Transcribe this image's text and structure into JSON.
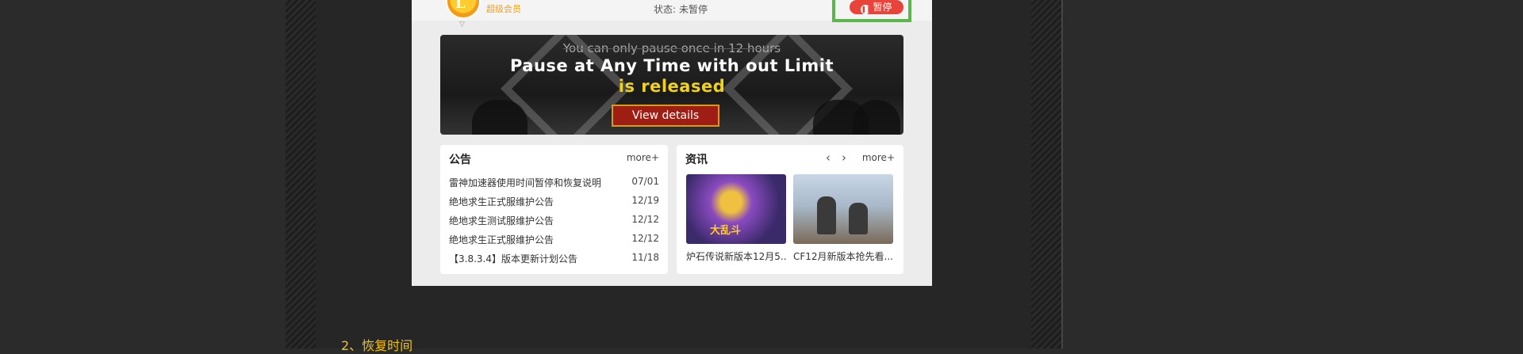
{
  "app": {
    "vip_logo_letter": "L",
    "vip_label": "超级会员",
    "status_label": "状态:",
    "status_value": "未暂停",
    "pause_button": "暂停"
  },
  "banner": {
    "strike_text": "You can only pause once in 12 hours",
    "title": "Pause at Any Time with out Limit",
    "subtitle": "is released",
    "button": "View details"
  },
  "announcements": {
    "title": "公告",
    "more": "more+",
    "items": [
      {
        "text": "雷神加速器使用时间暂停和恢复说明",
        "date": "07/01"
      },
      {
        "text": "绝地求生正式服维护公告",
        "date": "12/19"
      },
      {
        "text": "绝地求生测试服维护公告",
        "date": "12/12"
      },
      {
        "text": "绝地求生正式服维护公告",
        "date": "12/12"
      },
      {
        "text": "【3.8.3.4】版本更新计划公告",
        "date": "11/18"
      }
    ]
  },
  "info": {
    "title": "资讯",
    "more": "more+",
    "cards": [
      {
        "caption": "炉石传说新版本12月5...",
        "thumb_text": "大乱斗"
      },
      {
        "caption": "CF12月新版本抢先看..."
      }
    ]
  },
  "footer": {
    "step_text": "2、恢复时间"
  },
  "colors": {
    "page_bg": "#2b2b2b",
    "highlight_box": "#5ab84b",
    "pause_red": "#e8443a",
    "banner_yellow": "#f0d21a",
    "footer_text": "#f0c419"
  }
}
